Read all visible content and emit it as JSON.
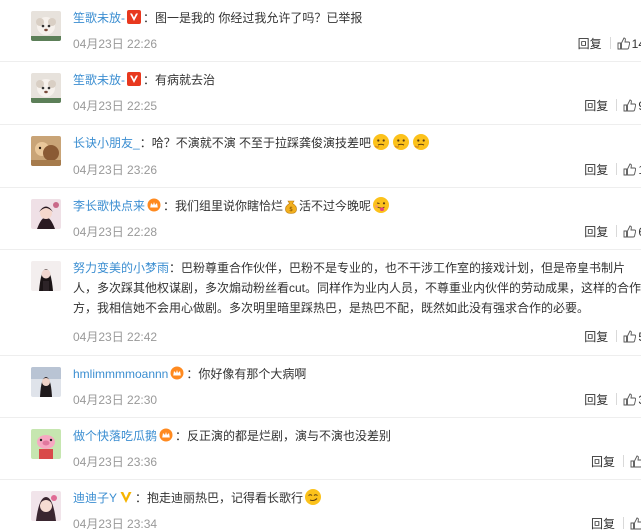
{
  "comments": [
    {
      "user": "笙歌未放-",
      "badge": "v-red",
      "sep": "：",
      "text": "图一是我的 你经过我允许了吗？已举报",
      "emojis": [],
      "time": "04月23日 22:26",
      "reply": "回复",
      "likes": "14"
    },
    {
      "user": "笙歌未放-",
      "badge": "v-red",
      "sep": "：",
      "text": "有病就去治",
      "emojis": [],
      "time": "04月23日 22:25",
      "reply": "回复",
      "likes": "9"
    },
    {
      "user": "长诀小朋友_",
      "badge": "",
      "sep": "：",
      "text": "哈？不演就不演 不至于拉踩龚俊演技差吧",
      "emojis": [
        "thinking-face-emoji",
        "thinking-face-emoji",
        "thinking-face-emoji"
      ],
      "time": "04月23日 23:26",
      "reply": "回复",
      "likes": "1"
    },
    {
      "user": "李长歌快点来",
      "badge": "fan-crown",
      "sep": "：",
      "text": "我们组里说你瞎恰烂",
      "text2": "活不过今晚呢",
      "emojis": [
        "money-bag-emoji",
        "tongue-face-emoji"
      ],
      "time": "04月23日 22:28",
      "reply": "回复",
      "likes": "6"
    },
    {
      "user": "努力变美的小梦雨",
      "badge": "",
      "sep": "：",
      "text": "巴粉尊重合作伙伴，巴粉不是专业的，也不干涉工作室的接戏计划，但是帝皇书制片人，多次踩其他权谋剧，多次煽动粉丝看cut。同样作为业内人员，不尊重业内伙伴的劳动成果，这样的合作方，我相信她不会用心做剧。多次明里暗里踩热巴，是热巴不配，既然如此没有强求合作的必要。",
      "emojis": [],
      "time": "04月23日 22:42",
      "reply": "回复",
      "likes": "5"
    },
    {
      "user": "hmlimmmmoannn",
      "badge": "fan-crown",
      "sep": "：",
      "text": "你好像有那个大病啊",
      "emojis": [],
      "time": "04月23日 22:30",
      "reply": "回复",
      "likes": "3"
    },
    {
      "user": "做个快落吃瓜鹅",
      "badge": "fan-crown",
      "sep": "：",
      "text": "反正演的都是烂剧，演与不演也没差别",
      "emojis": [],
      "time": "04月23日 23:36",
      "reply": "回复",
      "likes": ""
    },
    {
      "user": "迪迪子Y",
      "badge": "v-yellow",
      "sep": "：",
      "text": "抱走迪丽热巴，记得看长歌行",
      "emojis": [
        "smirk-face-emoji"
      ],
      "time": "04月23日 23:34",
      "reply": "回复",
      "likes": ""
    }
  ],
  "colors": {
    "name_orange": "#eb7350",
    "name_blue": "#3b8ed1",
    "badge_red": "#e8381e",
    "badge_yellow": "#f6b400",
    "meta_gray": "#999999"
  }
}
